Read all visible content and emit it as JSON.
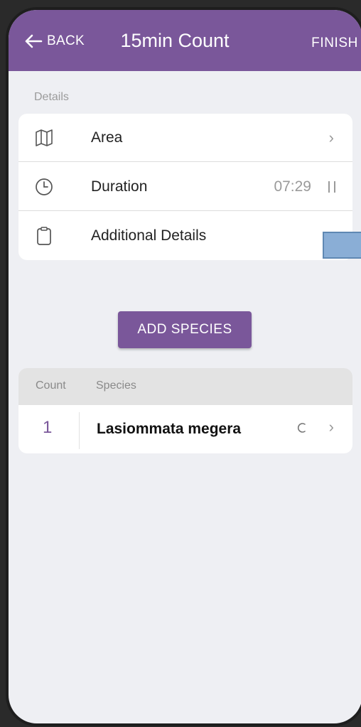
{
  "header": {
    "back_label": "BACK",
    "title": "15min Count",
    "finish_label": "FINISH",
    "color": "#7a579a"
  },
  "details": {
    "section_label": "Details",
    "rows": [
      {
        "icon": "map-icon",
        "label": "Area",
        "trailing": "chevron-right-icon"
      },
      {
        "icon": "clock-icon",
        "label": "Duration",
        "value": "07:29",
        "trailing": "pause-icon"
      },
      {
        "icon": "clipboard-icon",
        "label": "Additional Details"
      }
    ]
  },
  "add_species_label": "ADD SPECIES",
  "species_table": {
    "columns": [
      "Count",
      "Species"
    ],
    "rows": [
      {
        "count": "1",
        "name": "Lasiommata megera",
        "status_icon": "loading-spinner-icon",
        "trailing": "chevron-right-icon"
      }
    ]
  }
}
